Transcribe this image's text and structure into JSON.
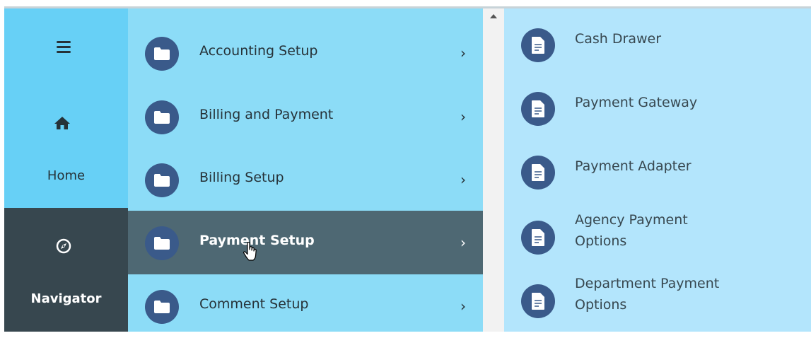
{
  "rail": {
    "menu_icon": "hamburger-icon",
    "home": {
      "label": "Home",
      "icon": "home-icon"
    },
    "navigator": {
      "label": "Navigator",
      "icon": "compass-icon"
    }
  },
  "menu": {
    "items": [
      {
        "label": "Accounting Setup",
        "icon": "folder-icon",
        "chevron": "›",
        "active": false
      },
      {
        "label": "Billing and Payment",
        "icon": "folder-icon",
        "chevron": "›",
        "active": false
      },
      {
        "label": "Billing Setup",
        "icon": "folder-icon",
        "chevron": "›",
        "active": false
      },
      {
        "label": "Payment Setup",
        "icon": "folder-icon",
        "chevron": "›",
        "active": true
      },
      {
        "label": "Comment Setup",
        "icon": "folder-icon",
        "chevron": "›",
        "active": false
      }
    ]
  },
  "submenu": {
    "items": [
      {
        "line1": "Cash Drawer",
        "line2": "",
        "icon": "document-icon"
      },
      {
        "line1": "Payment Gateway",
        "line2": "",
        "icon": "document-icon"
      },
      {
        "line1": "Payment Adapter",
        "line2": "",
        "icon": "document-icon"
      },
      {
        "line1": "Agency Payment",
        "line2": "Options",
        "icon": "document-icon"
      },
      {
        "line1": "Department Payment",
        "line2": "Options",
        "icon": "document-icon"
      }
    ]
  },
  "colors": {
    "rail_top": "#67d0f6",
    "rail_bottom": "#37474f",
    "menu_bg": "#8cdcf7",
    "menu_active": "#4e6873",
    "submenu_bg": "#b3e5fc",
    "badge": "#3a5a8a"
  }
}
